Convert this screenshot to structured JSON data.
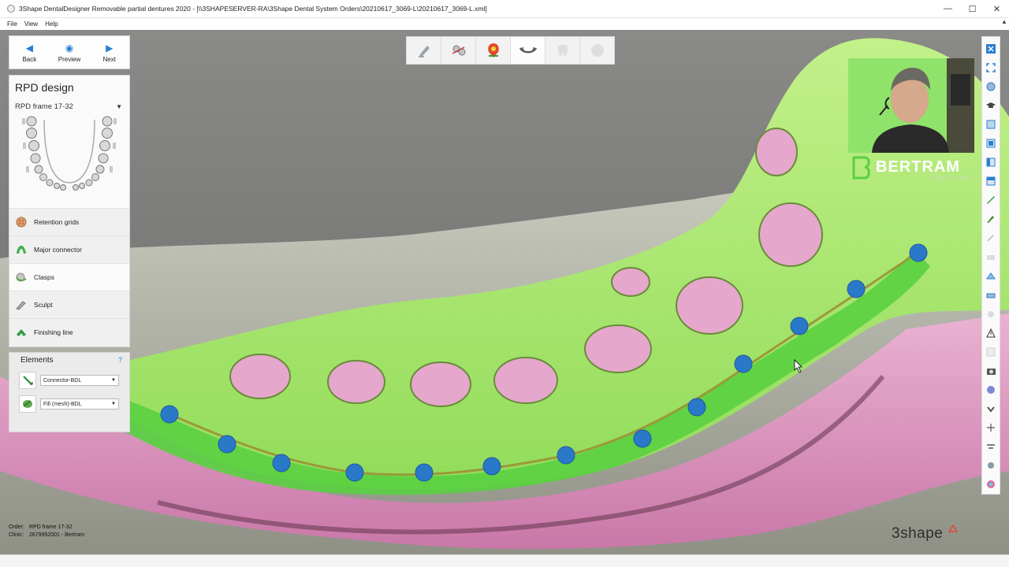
{
  "window": {
    "title": "3Shape DentalDesigner Removable partial dentures 2020 - [\\\\3SHAPESERVER-RA\\3Shape Dental System Orders\\20210617_3069-L\\20210617_3069-L.xml]",
    "minimize": "—",
    "maximize": "☐",
    "close": "✕"
  },
  "menu": [
    "File",
    "View",
    "Help"
  ],
  "nav": {
    "back": "Back",
    "preview": "Preview",
    "next": "Next"
  },
  "rpd": {
    "title": "RPD design",
    "frame_select": "RPD frame 17-32",
    "steps": [
      {
        "label": "Retention grids",
        "color": "#e8a070"
      },
      {
        "label": "Major connector",
        "color": "#3fae4a"
      },
      {
        "label": "Clasps",
        "color": "#5aa84a"
      },
      {
        "label": "Sculpt",
        "color": "#8a8a8a"
      },
      {
        "label": "Finishing line",
        "color": "#2f9a3f"
      }
    ],
    "active_step": "Clasps"
  },
  "elements": {
    "title": "Elements",
    "help": "?",
    "rows": [
      {
        "value": "Connector-BDL"
      },
      {
        "value": "Fill (mesh)-BDL"
      }
    ]
  },
  "order": {
    "order_label": "Order:",
    "order_value": "RPD frame 17-32",
    "clinic_label": "Clinic:",
    "clinic_value": "2679952001 - Bertram"
  },
  "brand": {
    "bertram": "BERTRAM",
    "bertram_sub": "DENTAL LAB",
    "threeshape": "3shape"
  },
  "colors": {
    "framework_green": "#a8e86a",
    "connector_green": "#5ad040",
    "gum_pink": "#e8a6cc",
    "blue_dots": "#2a78c8",
    "accent_blue": "#2a7fd0"
  }
}
